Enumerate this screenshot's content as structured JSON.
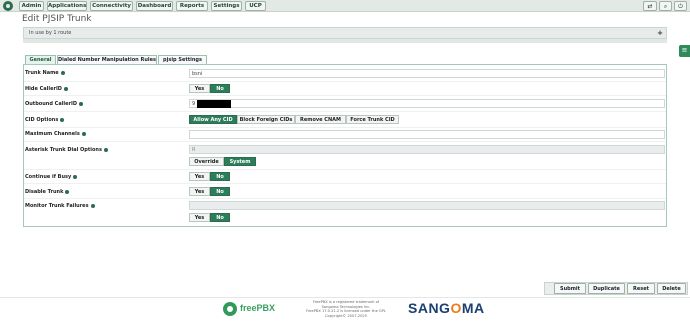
{
  "nav": {
    "items": [
      "Admin",
      "Applications",
      "Connectivity",
      "Dashboard",
      "Reports",
      "Settings",
      "UCP"
    ],
    "right_icons": [
      "language-icon",
      "search-icon",
      "logout-icon"
    ],
    "right_labels": [
      "⇄",
      "⌕",
      "⏻"
    ]
  },
  "page": {
    "title": "Edit PJSIP Trunk"
  },
  "in_use": {
    "text": "In use by 1 route",
    "toggle": "+"
  },
  "side_tab": {
    "label": "≡"
  },
  "tabs": [
    "General",
    "Dialed Number Manipulation Rules",
    "pjsip Settings"
  ],
  "form": {
    "trunk_name": {
      "label": "Trunk Name",
      "value": "bsni"
    },
    "hide_callerid": {
      "label": "Hide CallerID",
      "yes": "Yes",
      "no": "No",
      "selected": "No"
    },
    "outbound_callerid": {
      "label": "Outbound CallerID",
      "value": "9"
    },
    "cid_options": {
      "label": "CID Options",
      "options": [
        "Allow Any CID",
        "Block Foreign CIDs",
        "Remove CNAM",
        "Force Trunk CID"
      ],
      "selected": "Allow Any CID"
    },
    "max_channels": {
      "label": "Maximum Channels",
      "value": ""
    },
    "asterisk_dial_options": {
      "label": "Asterisk Trunk Dial Options",
      "value": "R",
      "override": "Override",
      "system": "System",
      "selected": "System"
    },
    "continue_if_busy": {
      "label": "Continue if Busy",
      "yes": "Yes",
      "no": "No",
      "selected": "No"
    },
    "disable_trunk": {
      "label": "Disable Trunk",
      "yes": "Yes",
      "no": "No",
      "selected": "No"
    },
    "monitor_trunk_failures": {
      "label": "Monitor Trunk Failures",
      "value": "",
      "yes": "Yes",
      "no": "No",
      "selected": "No"
    }
  },
  "actions": {
    "submit": "Submit",
    "duplicate": "Duplicate",
    "reset": "Reset",
    "delete": "Delete"
  },
  "footer": {
    "freepbx_brand": "freePBX",
    "legal_lines": [
      "FreePBX is a registered trademark of",
      "Sangoma Technologies Inc.",
      "FreePBX 17.0.21.2 is licensed under the GPL",
      "Copyright© 2007-2025"
    ],
    "sangoma_left": "SANG",
    "sangoma_o": "O",
    "sangoma_right": "MA"
  },
  "colors": {
    "accent": "#2e7d5a",
    "brand_green": "#3b9e5e",
    "sangoma_blue": "#1a3f73",
    "sangoma_orange": "#ef7b1c"
  }
}
